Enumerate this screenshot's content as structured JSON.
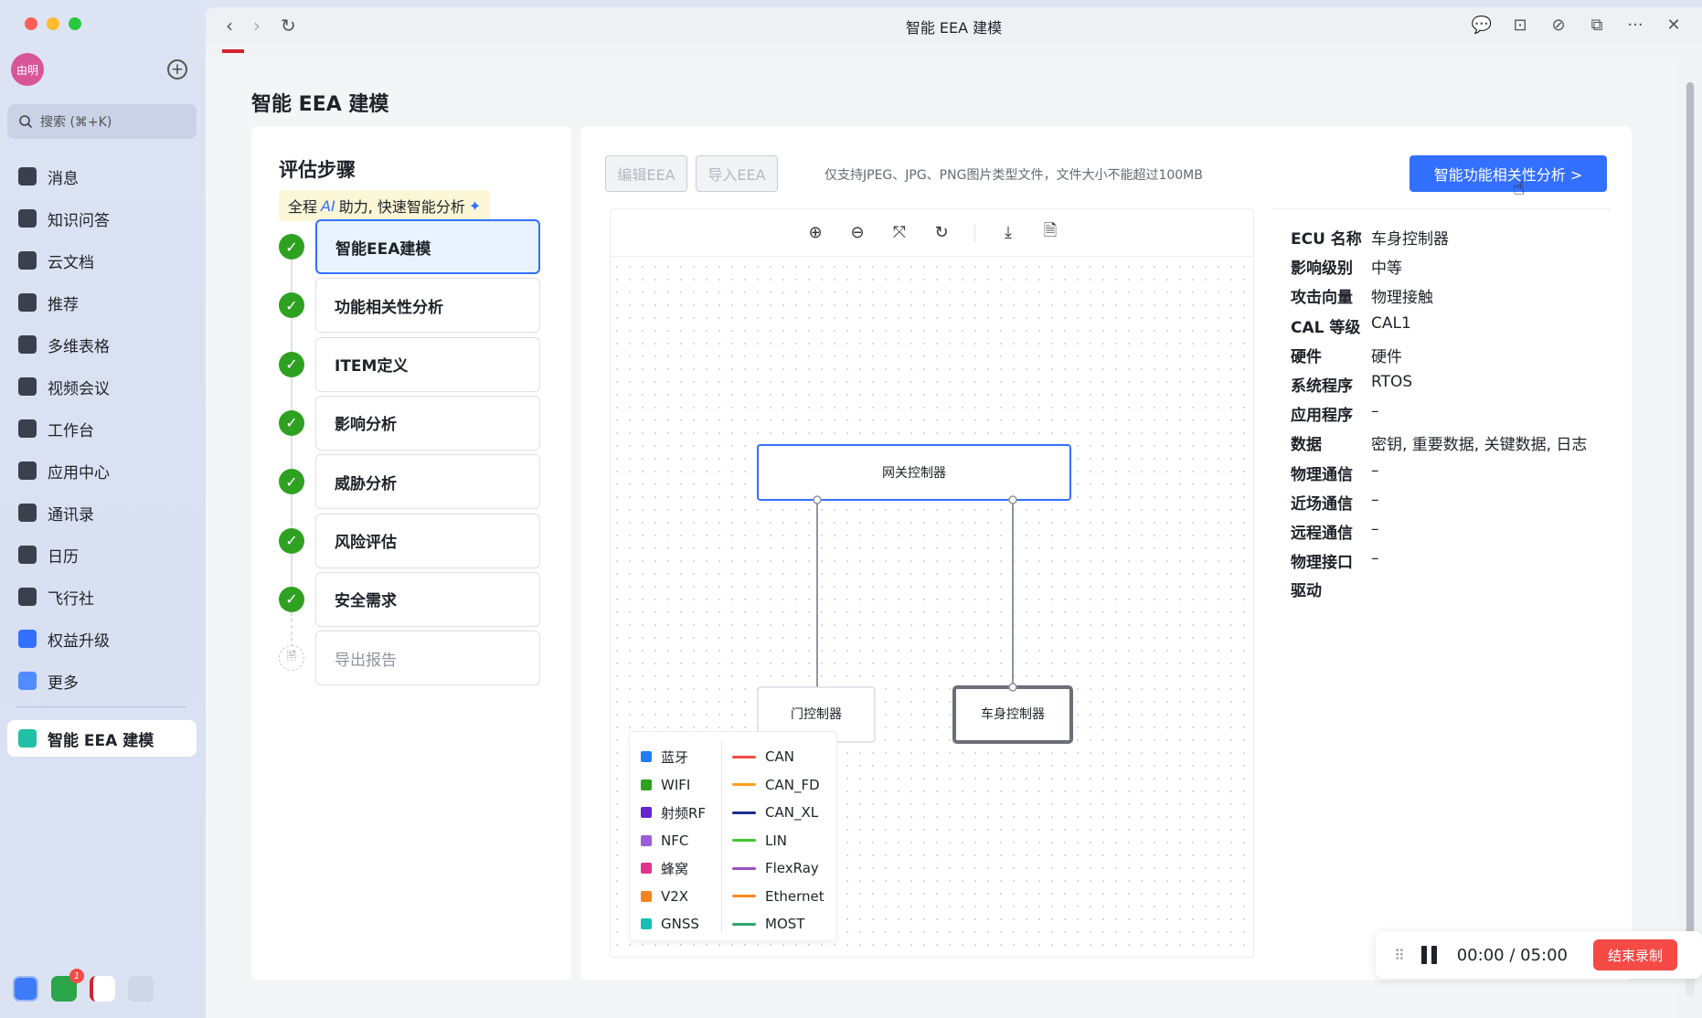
{
  "sidebar": {
    "avatar_text": "由明",
    "search_placeholder": "搜索 (⌘+K)",
    "items": [
      {
        "label": "消息",
        "icon": "chat-icon"
      },
      {
        "label": "知识问答",
        "icon": "qa-icon"
      },
      {
        "label": "云文档",
        "icon": "docs-icon"
      },
      {
        "label": "推荐",
        "icon": "recommend-icon"
      },
      {
        "label": "多维表格",
        "icon": "table-icon"
      },
      {
        "label": "视频会议",
        "icon": "video-icon"
      },
      {
        "label": "工作台",
        "icon": "workbench-icon"
      },
      {
        "label": "应用中心",
        "icon": "app-center-icon"
      },
      {
        "label": "通讯录",
        "icon": "contacts-icon"
      },
      {
        "label": "日历",
        "icon": "calendar-icon"
      },
      {
        "label": "飞行社",
        "icon": "community-icon"
      },
      {
        "label": "权益升级",
        "icon": "upgrade-icon"
      },
      {
        "label": "更多",
        "icon": "more-icon"
      }
    ],
    "active_app": "智能 EEA 建模",
    "dock_badge": "1"
  },
  "window": {
    "title": "智能 EEA 建模"
  },
  "page": {
    "title": "智能 EEA 建模"
  },
  "steps": {
    "heading": "评估步骤",
    "tip_prefix": "全程",
    "tip_ai": "AI",
    "tip_suffix": "助力, 快速智能分析",
    "items": [
      {
        "label": "智能EEA建模",
        "status": "done",
        "active": true
      },
      {
        "label": "功能相关性分析",
        "status": "done"
      },
      {
        "label": "ITEM定义",
        "status": "done"
      },
      {
        "label": "影响分析",
        "status": "done"
      },
      {
        "label": "威胁分析",
        "status": "done"
      },
      {
        "label": "风险评估",
        "status": "done"
      },
      {
        "label": "安全需求",
        "status": "done"
      },
      {
        "label": "导出报告",
        "status": "pending"
      }
    ]
  },
  "editor": {
    "edit_button": "编辑EEA",
    "import_button": "导入EEA",
    "upload_hint": "仅支持JPEG、JPG、PNG图片类型文件，文件大小不能超过100MB",
    "analyze_button": "智能功能相关性分析 >",
    "nodes": {
      "gateway": "网关控制器",
      "door": "门控制器",
      "body": "车身控制器"
    }
  },
  "ecu_info": [
    {
      "key": "ECU 名称",
      "value": "车身控制器"
    },
    {
      "key": "影响级别",
      "value": "中等"
    },
    {
      "key": "攻击向量",
      "value": "物理接触"
    },
    {
      "key": "CAL 等级",
      "value": "CAL1"
    },
    {
      "key": "硬件",
      "value": "硬件"
    },
    {
      "key": "系统程序",
      "value": "RTOS"
    },
    {
      "key": "应用程序",
      "value": "–"
    },
    {
      "key": "数据",
      "value": "密钥, 重要数据, 关键数据, 日志"
    },
    {
      "key": "物理通信",
      "value": "–"
    },
    {
      "key": "近场通信",
      "value": "–"
    },
    {
      "key": "远程通信",
      "value": "–"
    },
    {
      "key": "物理接口驱动",
      "key_line1": "物理接口",
      "key_line2": "驱动",
      "value": "–"
    }
  ],
  "legend": {
    "wireless": [
      {
        "label": "蓝牙",
        "color": "#1f7cf2"
      },
      {
        "label": "WIFI",
        "color": "#2ea121"
      },
      {
        "label": "射频RF",
        "color": "#6425d0"
      },
      {
        "label": "NFC",
        "color": "#9a5ed9"
      },
      {
        "label": "蜂窝",
        "color": "#e2328e"
      },
      {
        "label": "V2X",
        "color": "#f58220"
      },
      {
        "label": "GNSS",
        "color": "#14c0b3"
      }
    ],
    "wired": [
      {
        "label": "CAN",
        "color": "#f54a45"
      },
      {
        "label": "CAN_FD",
        "color": "#ff9d1c"
      },
      {
        "label": "CAN_XL",
        "color": "#1d2e8f"
      },
      {
        "label": "LIN",
        "color": "#3fc72e"
      },
      {
        "label": "FlexRay",
        "color": "#9b4fc6"
      },
      {
        "label": "Ethernet",
        "color": "#ff8a1f"
      },
      {
        "label": "MOST",
        "color": "#2ea36b"
      }
    ]
  },
  "recording": {
    "elapsed": "00:00",
    "separator": "/",
    "total": "05:00",
    "stop_label": "结束录制"
  },
  "colors": {
    "accent": "#3370ff",
    "success": "#2ea121",
    "danger": "#f54a45"
  }
}
